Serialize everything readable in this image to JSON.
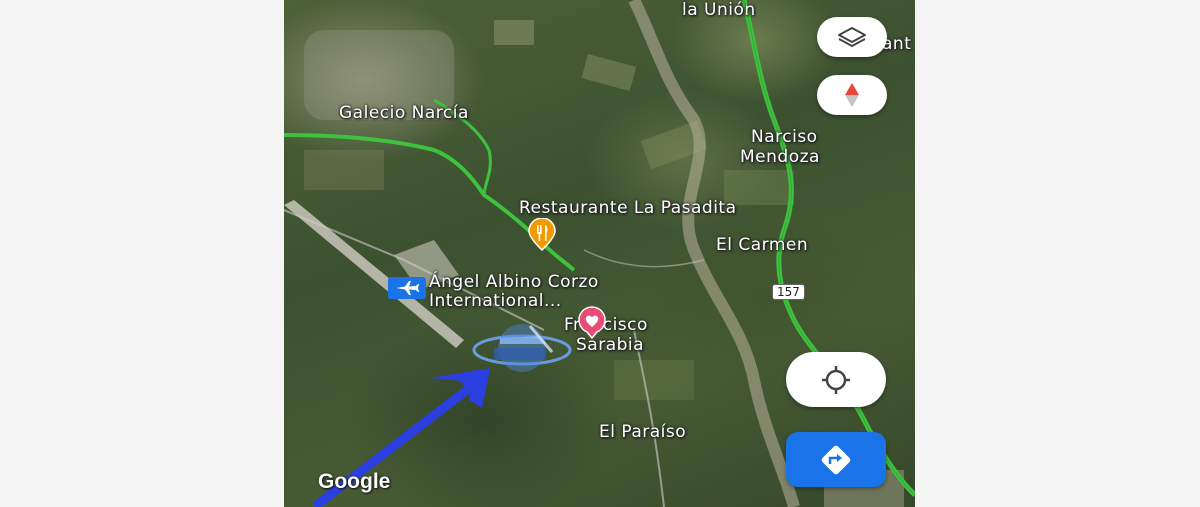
{
  "map": {
    "attribution": "Google",
    "places": {
      "la_union": "la Unión",
      "galecio_narcia": "Galecio Narcía",
      "narciso_mendoza_line1": "Narciso",
      "narciso_mendoza_line2": "Mendoza",
      "restaurante": "Restaurante La Pasadita",
      "el_carmen": "El Carmen",
      "airport_line1": "Ángel Albino Corzo",
      "airport_line2": "International...",
      "francisco_line1": "Francisco",
      "francisco_line2": "Sarabia",
      "el_paraiso": "El Paraíso",
      "edge_fragment": "ant"
    },
    "route_badge": "157"
  },
  "controls": {
    "layers_icon": "layers-icon",
    "compass_icon": "compass-icon",
    "my_location_icon": "my-location-icon",
    "directions_icon": "directions-icon"
  },
  "colors": {
    "directions_button": "#1a73e8",
    "road_highlight": "#3ec23e",
    "annotation_arrow": "#2b3fe0",
    "restaurant_pin": "#f29900",
    "saved_place_pin": "#e94b77",
    "airport_icon": "#1a73e8"
  }
}
